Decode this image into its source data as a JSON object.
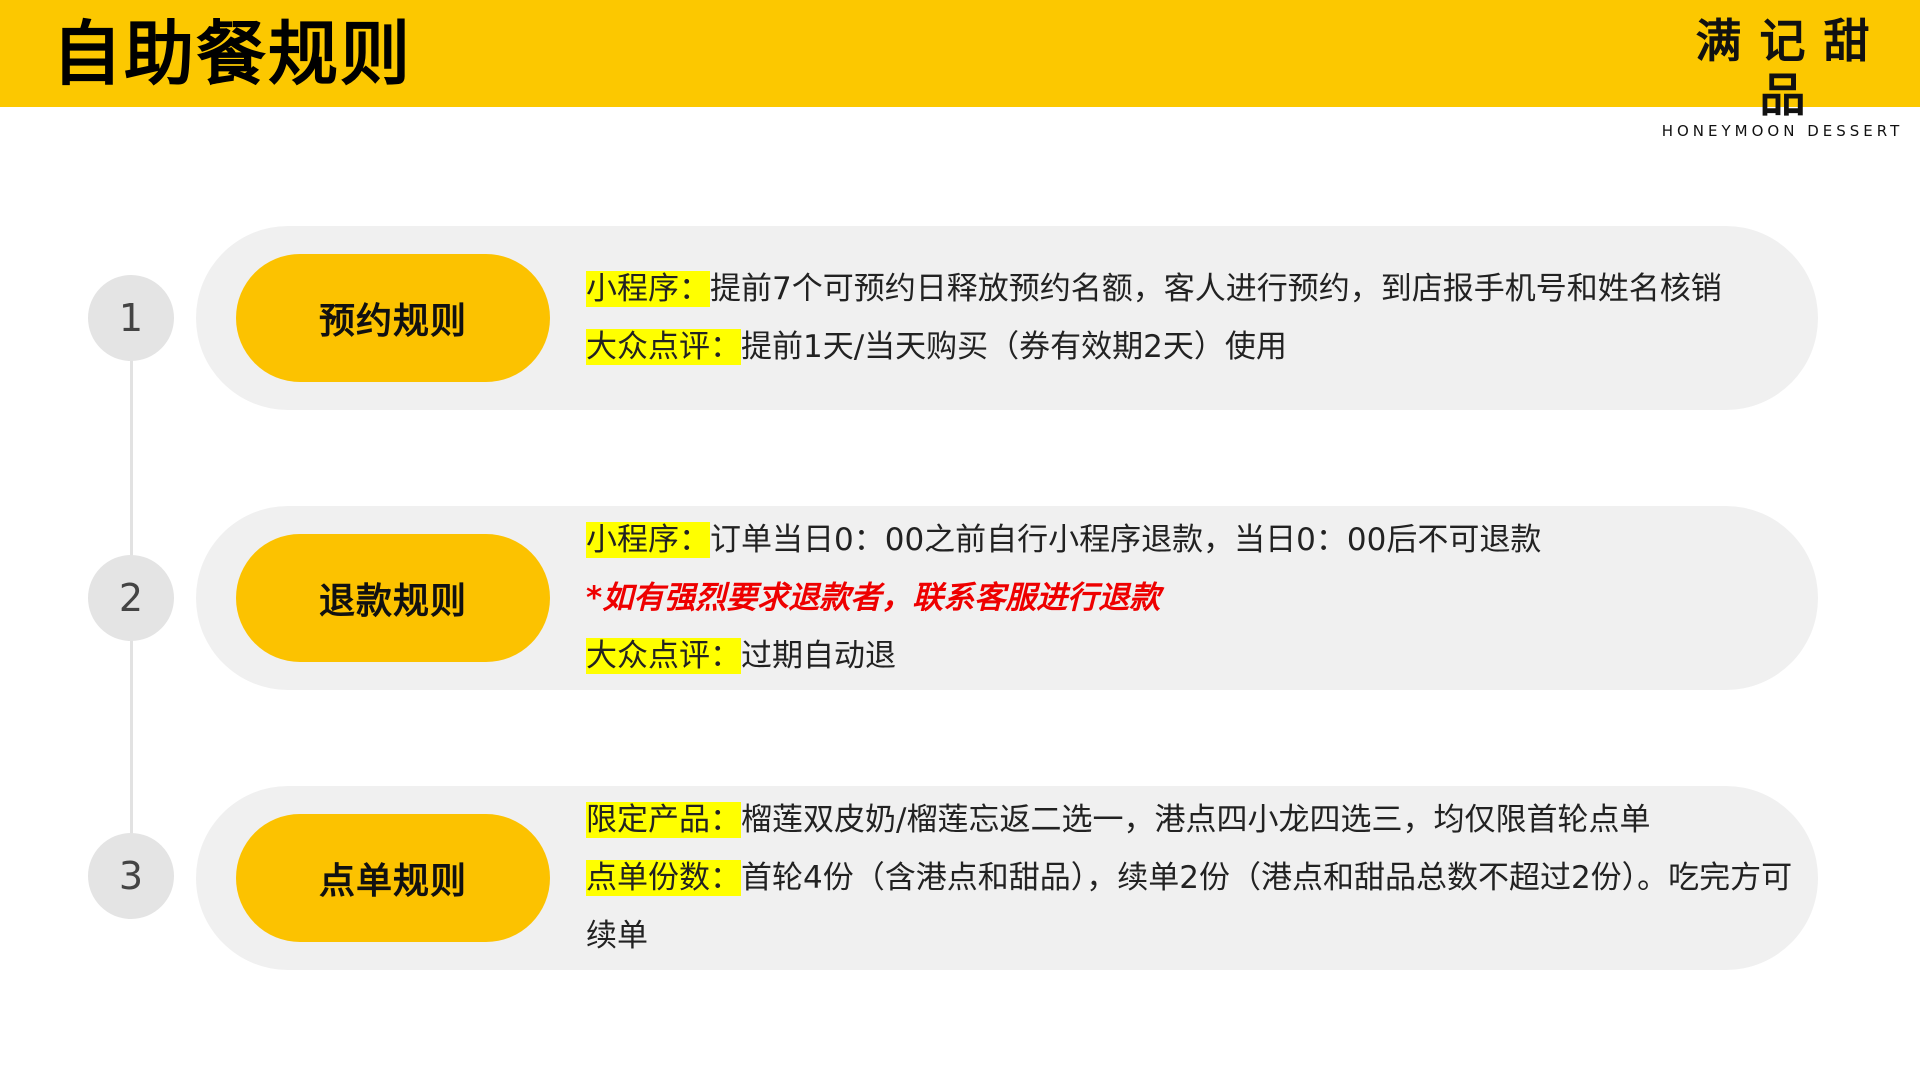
{
  "header": {
    "title": "自助餐规则",
    "logo_cn": "满记甜品",
    "logo_en": "HONEYMOON DESSERT"
  },
  "colors": {
    "accent": "#fcc800",
    "pill": "#fcc200",
    "highlight": "#ffff00",
    "warning": "#ee0000",
    "card_bg": "#f0f0f0"
  },
  "rules": [
    {
      "number": "1",
      "title": "预约规则",
      "lines": [
        {
          "label": "小程序：",
          "text": "提前7个可预约日释放预约名额，客人进行预约，到店报手机号和姓名核销"
        },
        {
          "label": "大众点评：",
          "text": "提前1天/当天购买（券有效期2天）使用"
        }
      ]
    },
    {
      "number": "2",
      "title": "退款规则",
      "lines": [
        {
          "label": "小程序：",
          "text": "订单当日0：00之前自行小程序退款，当日0：00后不可退款"
        },
        {
          "warning": "*如有强烈要求退款者，联系客服进行退款"
        },
        {
          "label": "大众点评：",
          "text": "过期自动退"
        }
      ]
    },
    {
      "number": "3",
      "title": "点单规则",
      "lines": [
        {
          "label": "限定产品：",
          "text": "榴莲双皮奶/榴莲忘返二选一，港点四小龙四选三，均仅限首轮点单"
        },
        {
          "label": "点单份数：",
          "text": "首轮4份（含港点和甜品），续单2份（港点和甜品总数不超过2份）。吃完方可续单"
        }
      ]
    }
  ]
}
